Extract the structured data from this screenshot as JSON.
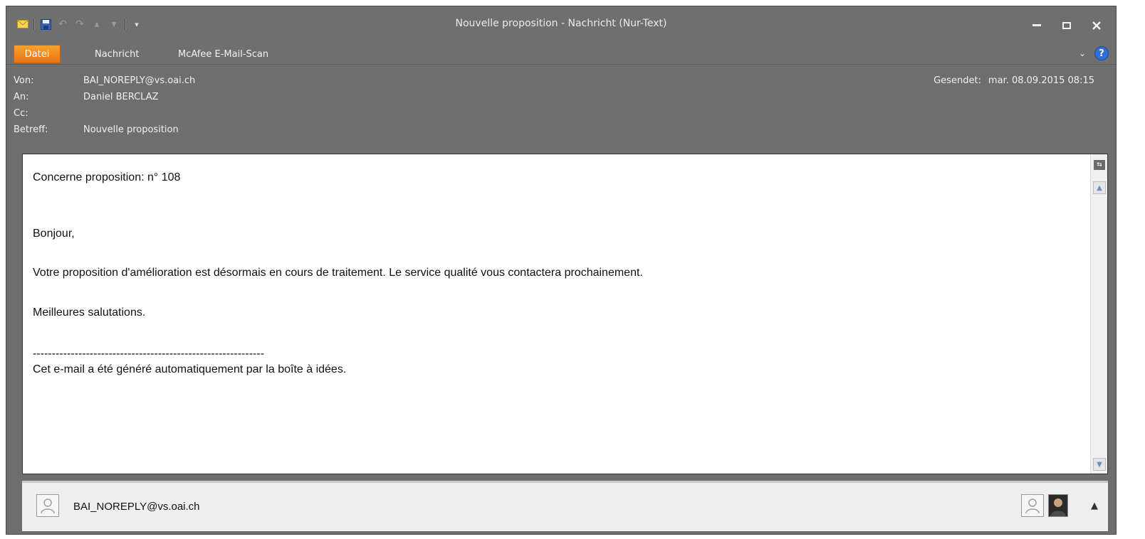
{
  "window": {
    "title": "Nouvelle proposition  -  Nachricht (Nur-Text)"
  },
  "qat": {
    "icons": [
      "mail-icon",
      "save-icon",
      "undo-icon",
      "redo-icon",
      "up-arrow-icon",
      "down-arrow-icon",
      "customize-icon"
    ]
  },
  "ribbon": {
    "file_tab": "Datei",
    "tabs": [
      "Nachricht",
      "McAfee E-Mail-Scan"
    ],
    "help": "?"
  },
  "header": {
    "from_label": "Von:",
    "from_value": "BAI_NOREPLY@vs.oai.ch",
    "to_label": "An:",
    "to_value": "Daniel BERCLAZ",
    "cc_label": "Cc:",
    "cc_value": "",
    "subject_label": "Betreff:",
    "subject_value": "Nouvelle proposition",
    "sent_label": "Gesendet:",
    "sent_value": "mar. 08.09.2015 08:15"
  },
  "body": {
    "line1": "Concerne proposition: n° 108",
    "line2": "Bonjour,",
    "line3": "Votre proposition d'amélioration est désormais en cours de traitement. Le service qualité vous contactera prochainement.",
    "line4": "Meilleures salutations.",
    "separator": "-------------------------------------------------------------",
    "line5": "Cet e-mail a été généré automatiquement par la boîte à idées."
  },
  "people_pane": {
    "sender": "BAI_NOREPLY@vs.oai.ch"
  }
}
